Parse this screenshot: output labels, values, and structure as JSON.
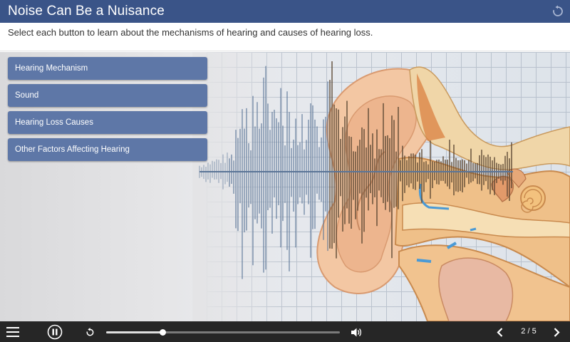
{
  "header": {
    "title": "Noise Can Be a Nuisance"
  },
  "instructions": "Select each button to learn about the mechanisms of hearing and causes of hearing loss.",
  "menu": {
    "items": [
      {
        "label": "Hearing Mechanism"
      },
      {
        "label": "Sound"
      },
      {
        "label": "Hearing Loss Causes"
      },
      {
        "label": "Other Factors Affecting Hearing"
      }
    ]
  },
  "toolbar": {
    "page_indicator": "2 / 5",
    "seek_progress": 0.24,
    "icons": [
      "menu-icon",
      "pause-icon",
      "replay-icon",
      "volume-icon",
      "prev-icon",
      "next-icon"
    ]
  },
  "colors": {
    "header_bg": "#3a5488",
    "button_bg": "#5e77a7",
    "toolbar_bg": "#262626"
  }
}
